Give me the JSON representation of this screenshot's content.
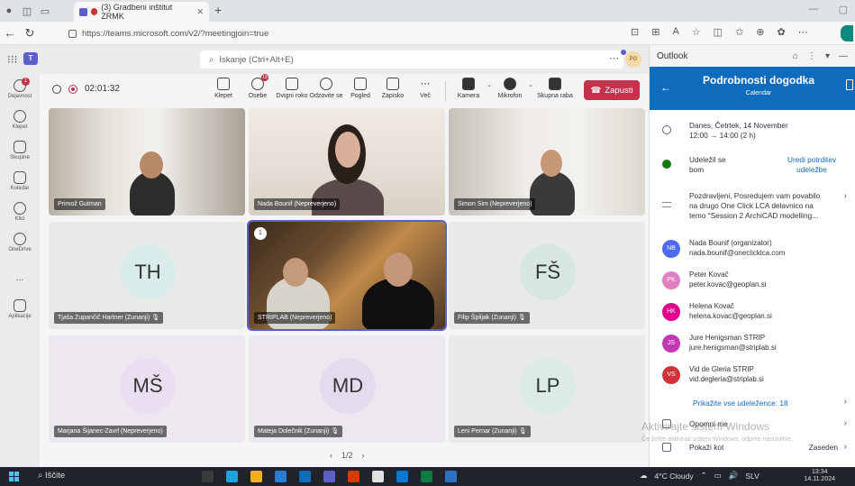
{
  "browser": {
    "tab_title": "(3) Gradbeni inštitut ZRMK",
    "url": "https://teams.microsoft.com/v2/?meetingjoin=true"
  },
  "teams": {
    "search_placeholder": "Iskanje (Ctrl+Alt+E)",
    "avatar_initials": "PG",
    "rail": [
      {
        "label": "Dejavnost",
        "badge": "1"
      },
      {
        "label": "Klepet"
      },
      {
        "label": "Skupine"
      },
      {
        "label": "Koledar"
      },
      {
        "label": "Klici"
      },
      {
        "label": "OneDrive"
      },
      {
        "label": "..."
      },
      {
        "label": "Aplikacije"
      }
    ]
  },
  "meeting": {
    "timer": "02:01:32",
    "controls": {
      "chat": "Klepet",
      "people": "Osebe",
      "people_badge": "19",
      "raise": "Dvigni roko",
      "react": "Odzovite se",
      "view": "Pogled",
      "notes": "Zapisko",
      "more": "Več",
      "camera": "Kamera",
      "mic": "Mikrofon",
      "share": "Skupna raba",
      "leave": "Zapusti"
    },
    "tiles": [
      {
        "name": "Primož Gutman"
      },
      {
        "name": "Nada Bounif (Nepreverjeno)"
      },
      {
        "name": "Simon Sim (Nepreverjeno)"
      },
      {
        "name": "Tjaša Zupančič Hartner (Zunanji)",
        "initials": "TH"
      },
      {
        "name": "STRIPLAB (Nepreverjeno)",
        "hand": "1"
      },
      {
        "name": "Filip Špiljak (Zunanji)",
        "initials": "FŠ"
      },
      {
        "name": "Marjana Šijanec-Zavrl (Nepreverjeno)",
        "initials": "MŠ"
      },
      {
        "name": "Mateja Dolečnik (Zunanji)",
        "initials": "MD"
      },
      {
        "name": "Leni Pernar (Zunanji)",
        "initials": "LP"
      }
    ],
    "pager": "1/2"
  },
  "outlook": {
    "app": "Outlook",
    "title": "Podrobnosti dogodka",
    "subtitle": "Calendar",
    "date_line1": "Danes, Četrtek, 14 November",
    "date_line2": "12:00 → 14:00 (2 h)",
    "rsvp_line1": "Udeležil se",
    "rsvp_line2": "bom",
    "edit_line1": "Uredi potrditev",
    "edit_line2": "udeležbe",
    "msg_line1": "Pozdravljeni, Posredujem vam povabilo",
    "msg_line2": "na drugo One Click LCA delavnico na",
    "msg_line3": "temo \"Session 2 ArchiCAD modelling...",
    "attendees": [
      {
        "initials": "NB",
        "name": "Nada Bounif (organizator)",
        "email": "nada.bounif@oneclicklca.com",
        "color": "#4f6bed"
      },
      {
        "initials": "PK",
        "name": "Peter Kovač",
        "email": "peter.kovac@geoplan.si",
        "color": "#e27fc2"
      },
      {
        "initials": "HK",
        "name": "Helena Kovač",
        "email": "helena.kovac@geoplan.si",
        "color": "#e3008c"
      },
      {
        "initials": "JS",
        "name": "Jure Henigsman STRIP",
        "email": "jure.henigsman@striplab.si",
        "color": "#c239b3"
      },
      {
        "initials": "VS",
        "name": "Vid de Gleria STRIP",
        "email": "vid.degleria@striplab.si",
        "color": "#d13438"
      }
    ],
    "show_all": "Prikažite vse udeležence: 18",
    "reminder": "Opomni me",
    "show_as": "Pokaži kot",
    "show_as_value": "Zaseden"
  },
  "watermark": {
    "line1": "Aktivirajte sistem Windows",
    "line2": "Če želite aktivirati sistem Windows, odprite nastavitve."
  },
  "taskbar": {
    "search": "Iščite",
    "weather": "4°C Cloudy",
    "lang": "SLV",
    "time": "13:34",
    "date": "14.11.2024"
  }
}
